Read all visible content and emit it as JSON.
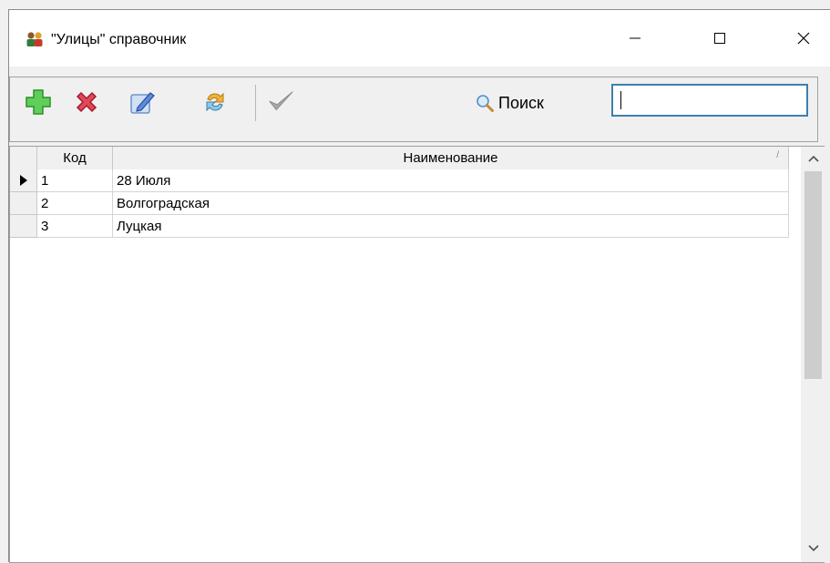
{
  "window": {
    "title": "\"Улицы\" справочник",
    "controls": {
      "minimize": "minimize",
      "maximize": "maximize",
      "close": "close"
    }
  },
  "toolbar": {
    "buttons": [
      {
        "name": "add-button",
        "icon": "plus-icon",
        "color": "#3cb043"
      },
      {
        "name": "delete-button",
        "icon": "delete-x-icon",
        "color": "#d9364a"
      },
      {
        "name": "edit-button",
        "icon": "edit-pencil-icon",
        "color": "#4b7bd6"
      },
      {
        "name": "refresh-button",
        "icon": "refresh-icon",
        "color": "#e0a12a"
      },
      {
        "name": "confirm-button",
        "icon": "checkmark-icon",
        "color": "#9a9a9a"
      }
    ],
    "search_label": "Поиск",
    "search_value": ""
  },
  "grid": {
    "columns": [
      "Код",
      "Наименование"
    ],
    "rows": [
      {
        "code": "1",
        "name": "28 Июля",
        "current": true
      },
      {
        "code": "2",
        "name": "Волгоградская",
        "current": false
      },
      {
        "code": "3",
        "name": "Луцкая",
        "current": false
      }
    ]
  },
  "colors": {
    "focus_border": "#3c7fb1",
    "grid_header": "#f0f0f0",
    "scroll_thumb": "#cdcdcd"
  }
}
